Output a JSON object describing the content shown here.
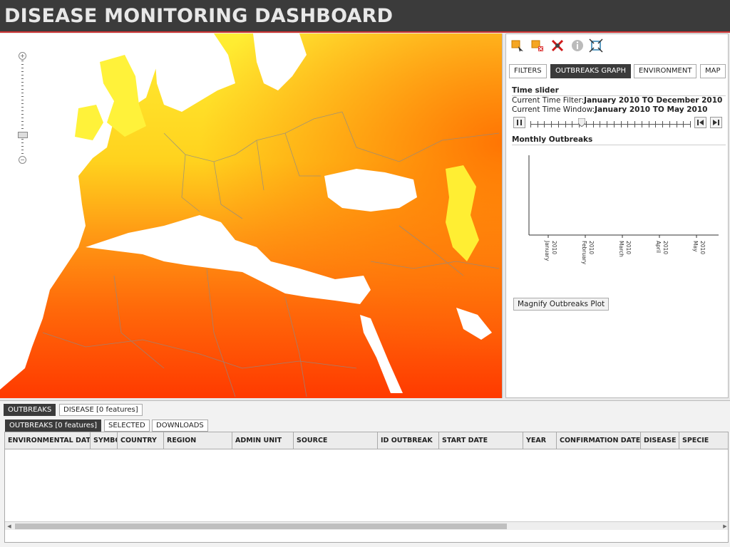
{
  "header": {
    "title": "DISEASE MONITORING DASHBOARD"
  },
  "toolbar": {
    "icons": [
      "select-feature-icon",
      "clear-selection-icon",
      "remove-icon",
      "info-icon",
      "zoom-extent-icon"
    ]
  },
  "panel": {
    "tabs": [
      "FILTERS",
      "OUTBREAKS GRAPH",
      "ENVIRONMENT",
      "MAP"
    ],
    "active_tab": "OUTBREAKS GRAPH",
    "time_slider_title": "Time slider",
    "filter_label": "Current Time Filter:",
    "filter_value": "January 2010 TO December 2010",
    "window_label": "Current Time Window:",
    "window_value": "January 2010 TO May 2010",
    "slider_ticks": 24,
    "slider_position": 0.32,
    "monthly_title": "Monthly Outbreaks",
    "magnify_label": "Magnify Outbreaks Plot"
  },
  "chart_data": {
    "type": "bar",
    "title": "Monthly Outbreaks",
    "categories": [
      "January 2010",
      "February 2010",
      "March 2010",
      "April 2010",
      "May 2010"
    ],
    "values": [
      0,
      0,
      0,
      0,
      0
    ]
  },
  "bottom": {
    "top_tabs": [
      "OUTBREAKS",
      "DISEASE [0 features]"
    ],
    "sub_tabs": [
      "OUTBREAKS [0 features]",
      "SELECTED",
      "DOWNLOADS"
    ],
    "columns": [
      "ENVIRONMENTAL DATA",
      "SYMBOL",
      "COUNTRY",
      "REGION",
      "ADMIN UNIT",
      "SOURCE",
      "ID OUTBREAK",
      "START DATE",
      "YEAR",
      "CONFIRMATION DATE",
      "DISEASE",
      "SPECIE"
    ]
  },
  "colors": {
    "header_bg": "#3b3b3b",
    "accent_line": "#cc3333",
    "map_cool": "#fff23a",
    "map_hot": "#ff3a00",
    "sea": "#ffffff"
  }
}
